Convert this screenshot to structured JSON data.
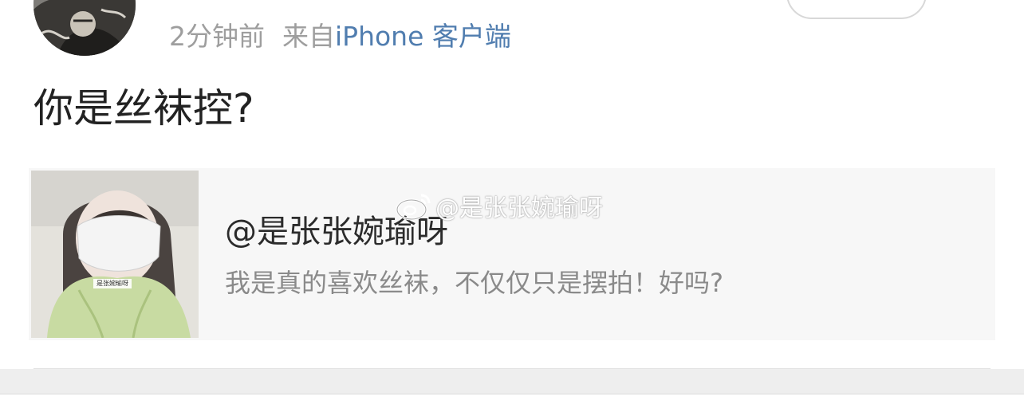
{
  "post": {
    "meta": {
      "time": "2分钟前",
      "from_label": "来自",
      "source": "iPhone 客户端"
    },
    "text": "你是丝袜控?",
    "shared_card": {
      "title": "@是张张婉瑜呀",
      "description": "我是真的喜欢丝袜，不仅仅只是摆拍！好吗?",
      "thumbnail_caption": "是张婉瑜呀"
    },
    "watermark": "@是张张婉瑜呀"
  }
}
